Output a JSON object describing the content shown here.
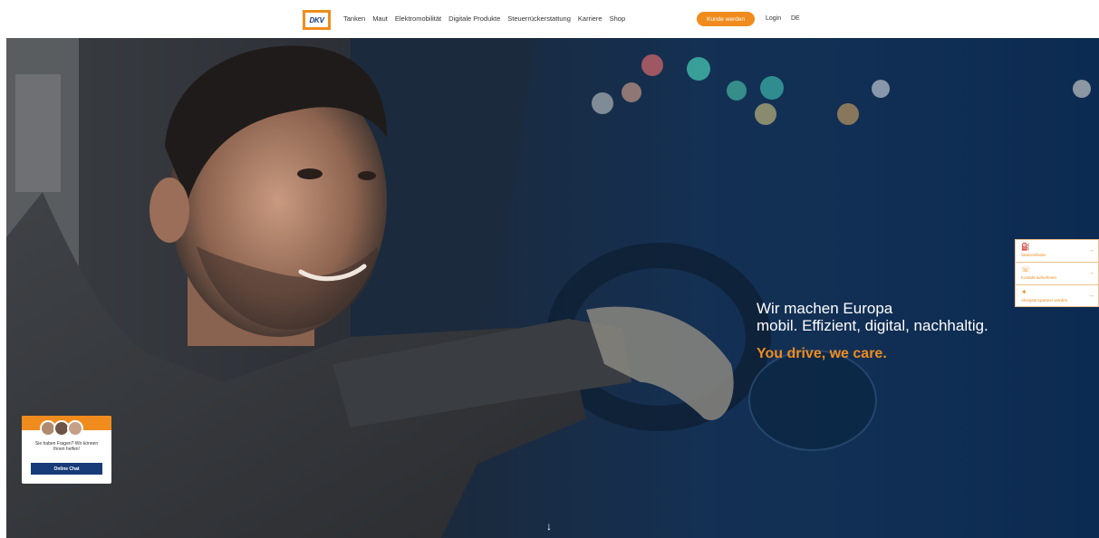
{
  "header": {
    "logo_text": "DKV",
    "nav_items": [
      "Tanken",
      "Maut",
      "Elektromobilität",
      "Digitale Produkte",
      "Steuerrückerstattung",
      "Karriere",
      "Shop"
    ],
    "cta_label": "Kunde werden",
    "login_label": "Login",
    "language": "DE"
  },
  "hero": {
    "headline_line1": "Wir machen Europa",
    "headline_line2": "mobil. Effizient, digital, nachhaltig.",
    "tagline": "You drive, we care.",
    "scroll_icon": "arrow-down-icon"
  },
  "side_panel": {
    "items": [
      {
        "label": "Stationsfinder",
        "icon": "station-icon"
      },
      {
        "label": "Kontakt aufnehmen",
        "icon": "contact-icon"
      },
      {
        "label": "Akzeptanzpartner werden",
        "icon": "partner-icon"
      }
    ]
  },
  "chat": {
    "message_line1": "Sie haben Fragen? Wir können",
    "message_line2": "Ihnen helfen!",
    "button_label": "Online Chat"
  },
  "colors": {
    "accent": "#f08c1e",
    "brand_blue": "#163b78"
  }
}
